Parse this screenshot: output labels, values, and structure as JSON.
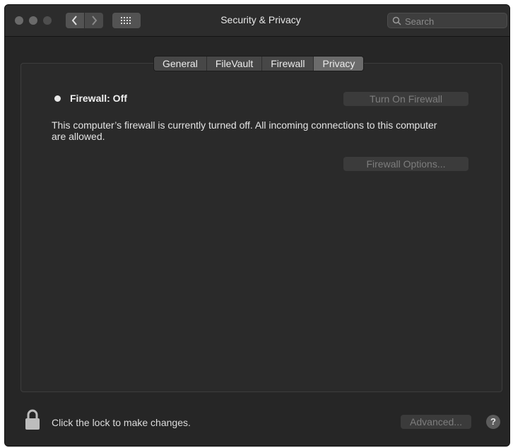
{
  "window": {
    "title": "Security & Privacy"
  },
  "search": {
    "placeholder": "Search",
    "value": ""
  },
  "tabs": [
    {
      "label": "General",
      "selected": false
    },
    {
      "label": "FileVault",
      "selected": false
    },
    {
      "label": "Firewall",
      "selected": false
    },
    {
      "label": "Privacy",
      "selected": true
    }
  ],
  "firewall": {
    "status_label": "Firewall: Off",
    "description": "This computer’s firewall is currently turned off. All incoming connections to this computer are allowed.",
    "turn_on_label": "Turn On Firewall",
    "options_label": "Firewall Options..."
  },
  "footer": {
    "lock_text": "Click the lock to make changes.",
    "advanced_label": "Advanced...",
    "help_label": "?"
  },
  "icons": {
    "back": "chevron-left-icon",
    "forward": "chevron-right-icon",
    "grid": "grid-icon",
    "search": "magnifier-icon",
    "lock": "lock-icon"
  },
  "colors": {
    "window_bg": "#262626",
    "panel_bg": "#2a2a2a",
    "text": "#e6e6e6",
    "disabled_text": "#7d7d7d"
  }
}
